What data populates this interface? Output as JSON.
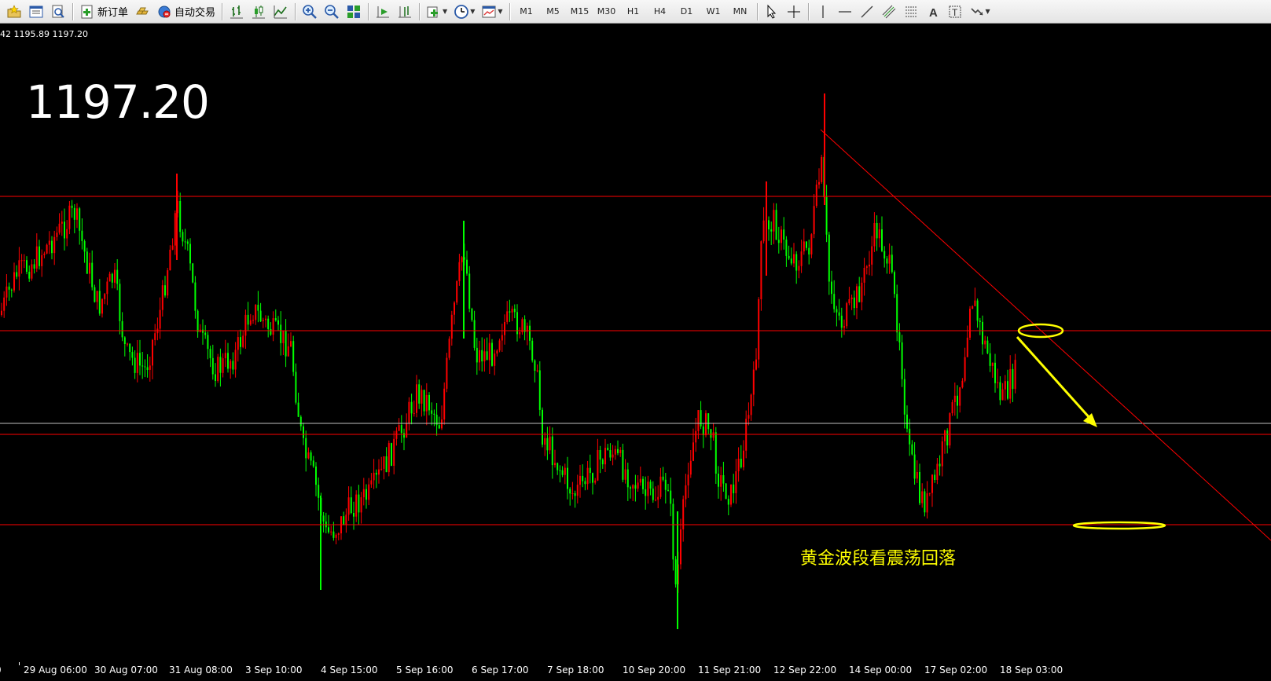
{
  "toolbar": {
    "new_order_label": "新订单",
    "auto_trading_label": "自动交易",
    "timeframes": [
      "M1",
      "M5",
      "M15",
      "M30",
      "H1",
      "H4",
      "D1",
      "W1",
      "MN"
    ]
  },
  "chart": {
    "ohlc_text": "42 1195.89 1197.20",
    "current_price": "1197.20",
    "annotation": "黄金波段看震荡回落",
    "colors": {
      "background": "#000000",
      "bull_candle": "#ff0000",
      "bear_candle": "#00ff00",
      "horizontal_lines": "#ff0000",
      "trendline": "#ff0000",
      "bid_line": "#c0c0c0",
      "annotation": "#ffff00"
    },
    "time_labels": [
      "0",
      "29 Aug 06:00",
      "30 Aug 07:00",
      "31 Aug 08:00",
      "3 Sep 10:00",
      "4 Sep 15:00",
      "5 Sep 16:00",
      "6 Sep 17:00",
      "7 Sep 18:00",
      "10 Sep 20:00",
      "11 Sep 21:00",
      "12 Sep 22:00",
      "14 Sep 00:00",
      "17 Sep 02:00",
      "18 Sep 03:00"
    ]
  }
}
